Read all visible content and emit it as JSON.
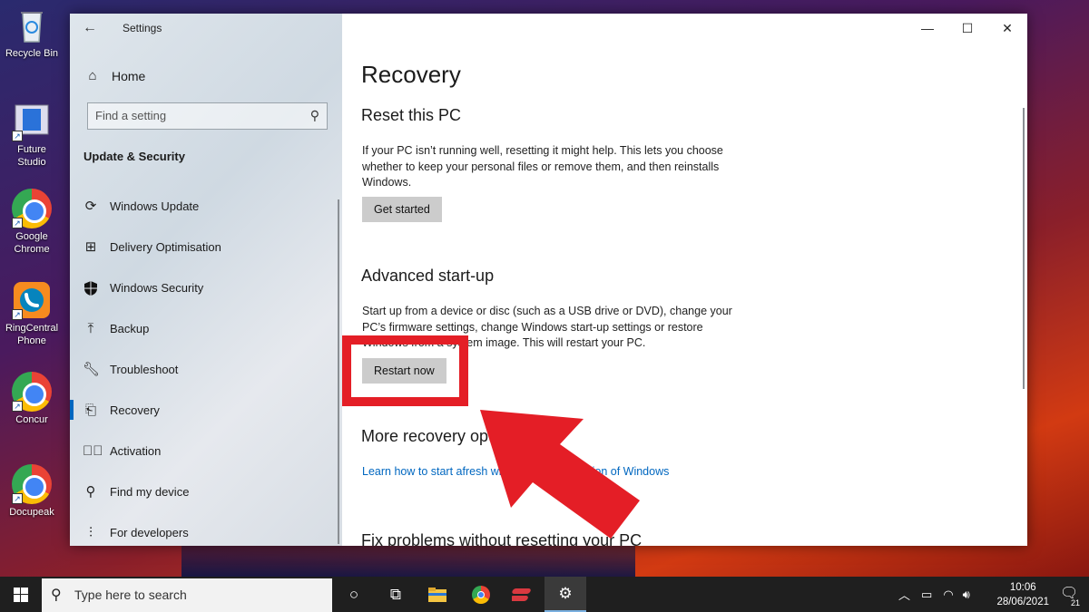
{
  "desktop": {
    "icons": [
      {
        "label": "Recycle Bin",
        "icon": "recycle-bin-icon"
      },
      {
        "label": "Future Studio",
        "icon": "future-studio-icon"
      },
      {
        "label": "Google Chrome",
        "icon": "chrome-icon"
      },
      {
        "label": "RingCentral Phone",
        "icon": "ringcentral-icon"
      },
      {
        "label": "Concur",
        "icon": "chrome-icon"
      },
      {
        "label": "Docupeak",
        "icon": "chrome-icon"
      }
    ]
  },
  "window": {
    "title": "Settings",
    "controls": {
      "minimize": "—",
      "maximize": "☐",
      "close": "✕"
    }
  },
  "sidebar": {
    "home": "Home",
    "search_placeholder": "Find a setting",
    "section": "Update & Security",
    "items": [
      {
        "label": "Windows Update",
        "icon": "refresh-icon"
      },
      {
        "label": "Delivery Optimisation",
        "icon": "delivery-icon"
      },
      {
        "label": "Windows Security",
        "icon": "shield-icon"
      },
      {
        "label": "Backup",
        "icon": "upload-icon"
      },
      {
        "label": "Troubleshoot",
        "icon": "wrench-icon"
      },
      {
        "label": "Recovery",
        "icon": "recovery-icon"
      },
      {
        "label": "Activation",
        "icon": "check-circle-icon"
      },
      {
        "label": "Find my device",
        "icon": "person-icon"
      },
      {
        "label": "For developers",
        "icon": "sliders-icon"
      }
    ],
    "active_item": "Recovery"
  },
  "main": {
    "title": "Recovery",
    "reset": {
      "heading": "Reset this PC",
      "description": "If your PC isn’t running well, resetting it might help. This lets you choose whether to keep your personal files or remove them, and then reinstalls Windows.",
      "button": "Get started"
    },
    "advanced": {
      "heading": "Advanced start-up",
      "description": "Start up from a device or disc (such as a USB drive or DVD), change your PC’s firmware settings, change Windows start-up settings or restore Windows from a system image. This will restart your PC.",
      "button": "Restart now"
    },
    "more": {
      "heading": "More recovery options",
      "link": "Learn how to start afresh with a clean installation of Windows"
    },
    "fix": {
      "heading": "Fix problems without resetting your PC"
    }
  },
  "annotation": {
    "color": "#e41e26"
  },
  "taskbar": {
    "search_placeholder": "Type here to search",
    "time": "10:06",
    "date": "28/06/2021",
    "notification_count": "21"
  }
}
